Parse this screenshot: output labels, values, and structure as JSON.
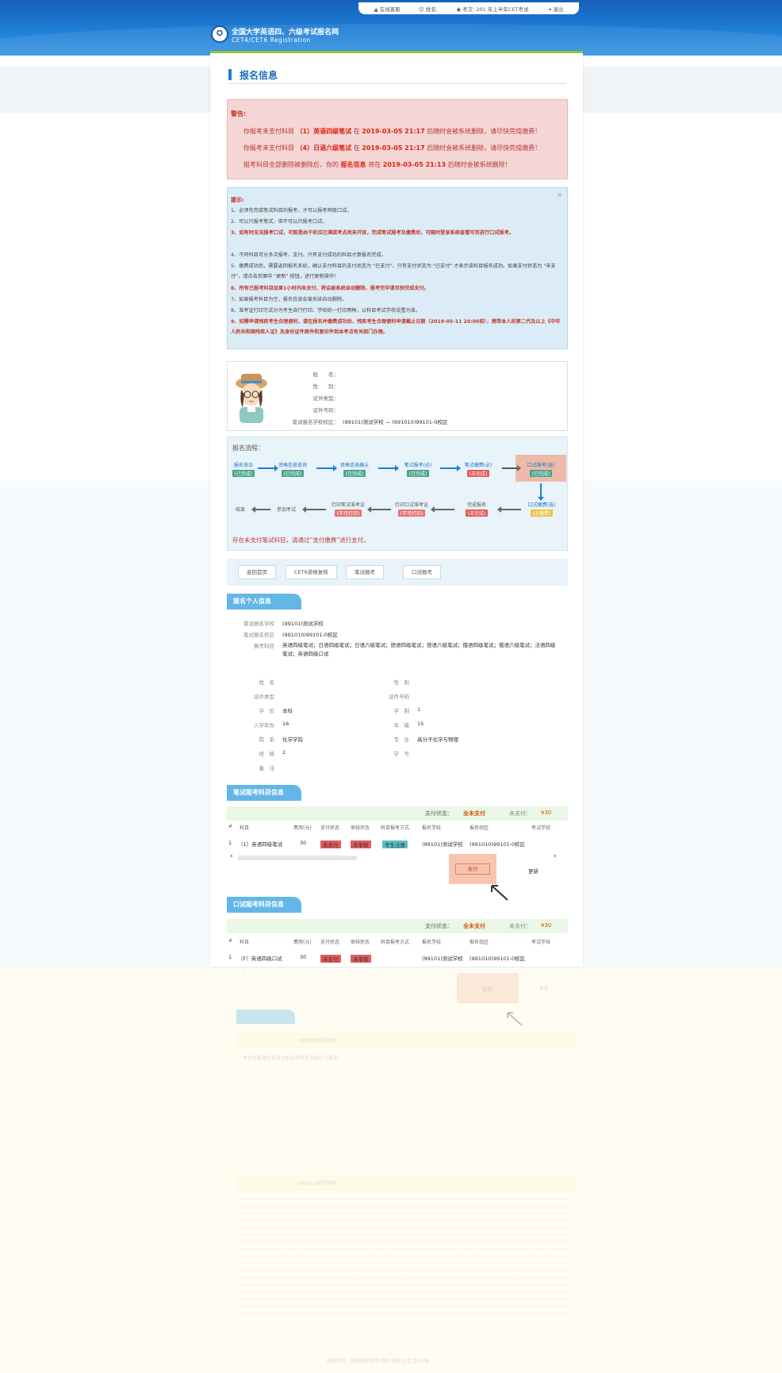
{
  "topbar": {
    "help": "在线客服",
    "name": "姓名:",
    "exam": "考次: 201 年上半年CET考试",
    "logout": "退出"
  },
  "logo": {
    "cn": "全国大学英语四、六级考试报名网",
    "en": "CET4/CET6 Registration"
  },
  "page_title": "报名信息",
  "warning": {
    "heading": "警告:",
    "lines": [
      {
        "pre": "你报考未支付科目",
        "item": "（1）英语四级笔试",
        "mid": "在",
        "date": "2019-03-05 21:17",
        "post": "后随时会被系统删除，请尽快完成缴费！"
      },
      {
        "pre": "你报考未支付科目",
        "item": "（4）日语六级笔试",
        "mid": "在",
        "date": "2019-03-05 21:17",
        "post": "后随时会被系统删除，请尽快完成缴费！"
      },
      {
        "pre": "报考科目全部删除被删除后，你的",
        "item": "报名信息",
        "mid": "将在",
        "date": "2019-03-05 21:13",
        "post": "后随时会被系统删除！"
      }
    ]
  },
  "tips": {
    "heading": "提示:",
    "close": "×",
    "items": [
      {
        "text": "1、必须先完成笔试科目的报考，才可以报考同级口试。",
        "red": false
      },
      {
        "text": "2、可以只报考笔试，但不可以只报考口试。",
        "red": false
      },
      {
        "text": "3、如有时无法报考口试，可能是由于机位已满或考点尚未开放，完成笔试报考及缴费后，可随时登录系统查看可否进行口试报考。",
        "red": true
      },
      {
        "text": "4、不同科目可分多次报考、支付。只有支付成功的科目才算报名完成。",
        "red": false
      },
      {
        "text": "5、缴费成功后，需要返回报名系统，确认支付科目的支付状态为 \"已支付\"，只有支付状态为 \"已支付\" 才表示该科目报名成功。如果支付状态为 \"未支付\"，请点击页面中 \"更新\" 按钮，进行更新操作！",
        "red": false
      },
      {
        "text": "6、所有已报考科目如果1小时内未支付，将会被系统自动删除，报考完毕请尽快完成支付。",
        "red": true
      },
      {
        "text": "7、如果报考科目为空，报名信息会被系统自动删除。",
        "red": false
      },
      {
        "text": "8、准考证打印方式分为考生自行打印、学校统一打印两种，以科目考试学校设置为准。",
        "red": false
      },
      {
        "text": "9、如需申请残疾考生合理便利，请在报名并缴费成功后，残疾考生合理便利申请截止日期（2019-05-11 20:00前），携带本人的第二代及以上《中华人民共和国残疾人证》及身份证件原件和复印件到本考点有关部门办理。",
        "red": true
      }
    ]
  },
  "profile": {
    "labels": [
      "姓　　名：",
      "性　　别：",
      "证件类型：",
      "证件号码：",
      "笔试报名学校校区："
    ],
    "school": "(99101)测试学校 — (991010)99101-0校区"
  },
  "flow": {
    "heading": "报名流程：",
    "row1": [
      {
        "label": "报名协议",
        "status": "(已完成)",
        "kind": "done"
      },
      {
        "label": "资格信息查询",
        "status": "(已完成)",
        "kind": "done"
      },
      {
        "label": "资格信息确认",
        "status": "(已完成)",
        "kind": "done"
      },
      {
        "label": "笔试报考(必)",
        "status": "(已完成)",
        "kind": "done"
      },
      {
        "label": "笔试缴费(必)",
        "status": "(未完成)",
        "kind": "undone"
      },
      {
        "label": "口试报考(选)",
        "status": "(已完成)",
        "kind": "done"
      }
    ],
    "row2": [
      {
        "label": "结束",
        "status": "",
        "kind": ""
      },
      {
        "label": "参加考试",
        "status": "",
        "kind": ""
      },
      {
        "label": "打印笔试准考证",
        "status": "(不可打印)",
        "kind": "cannot"
      },
      {
        "label": "打印口试准考证",
        "status": "(不可打印)",
        "kind": "cannot"
      },
      {
        "label": "完成报名",
        "status": "(未完成)",
        "kind": "undone"
      },
      {
        "label": "口试缴费(选)",
        "status": "(未缴费)",
        "kind": "yellow"
      }
    ],
    "note": "存在未支付笔试科目，请通过“支付缴费”进行支付。"
  },
  "nav": {
    "home": "返回首页",
    "cet6": "CET6资格复核",
    "written": "笔试报考",
    "oral": "口试报考"
  },
  "personal": {
    "title": "报名个人信息",
    "school_label": "笔试报名学校",
    "school_value": "(99101)测试学校",
    "campus_label": "笔试报名校区",
    "campus_value": "(991010)99101-0校区",
    "subjects_label": "报考科目",
    "subjects_value": "英语四级笔试；日语四级笔试；日语六级笔试；德语四级笔试；德语六级笔试；俄语四级笔试；俄语六级笔试；法语四级笔试；英语四级口试",
    "fields_left": [
      {
        "label": "姓　名",
        "value": ""
      },
      {
        "label": "证件类型",
        "value": ""
      },
      {
        "label": "学　历",
        "value": "本科"
      },
      {
        "label": "入学年份",
        "value": "16"
      },
      {
        "label": "院　系",
        "value": "化学学院"
      },
      {
        "label": "班　级",
        "value": "2"
      },
      {
        "label": "备　注",
        "value": ""
      }
    ],
    "fields_right": [
      {
        "label": "性　别",
        "value": ""
      },
      {
        "label": "证件号码",
        "value": ""
      },
      {
        "label": "学　制",
        "value": "1"
      },
      {
        "label": "年　级",
        "value": "15"
      },
      {
        "label": "专　业",
        "value": "高分子化学与物理"
      },
      {
        "label": "学　号",
        "value": ""
      }
    ]
  },
  "written_table": {
    "title": "笔试报考科目信息",
    "pay_status_label": "支付状态：",
    "pay_status_value": "全未支付",
    "unpaid_label": "未支付：",
    "unpaid_value": "¥30",
    "headers": [
      "#",
      "科目",
      "费用(元)",
      "支付状态",
      "审核状态",
      "科目报考方式",
      "报名学校",
      "报名校区",
      "考试学校"
    ],
    "rows": [
      {
        "no": "1",
        "subject": "（1）英语四级笔试",
        "fee": "30",
        "pay": "未支付",
        "audit": "未审核",
        "method": "考生注册",
        "school": "(99101)测试学校",
        "campus": "(991010)99101-0校区",
        "exam_school": ""
      }
    ],
    "pay_button": "支付",
    "update_button": "更新"
  },
  "oral_table": {
    "title": "口试报考科目信息",
    "pay_status_label": "支付状态：",
    "pay_status_value": "全未支付",
    "unpaid_label": "未支付：",
    "unpaid_value": "¥30",
    "headers": [
      "#",
      "科目",
      "费用(元)",
      "支付状态",
      "审核状态",
      "科目报考方式",
      "报名学校",
      "报名校区",
      "考试学校"
    ],
    "rows": [
      {
        "no": "1",
        "subject": "（F）英语四级口试",
        "fee": "30",
        "pay": "未支付",
        "audit": "未审核",
        "method": "",
        "school": "(99101)测试学校",
        "campus": "(991010)99101-0校区",
        "exam_school": ""
      }
    ],
    "pay_button": "支付",
    "update_button": "更新"
  },
  "faded": {
    "notice1_title": "(99101)测试学校",
    "notice1_text": "考生在报考科目支付前必须首先阅读以下条款。",
    "notice2_title": "(99101)测试学校",
    "footer": "版权所有：教育部教育考试院 中国·北京 京ICP备",
    "footer2": "京公网安备"
  },
  "colors": {
    "header": "#1f7fd6",
    "accent_green": "#8fc247",
    "warning_bg": "#f5d6d6",
    "tips_bg": "#dcecf6",
    "section": "#63b7e8"
  }
}
